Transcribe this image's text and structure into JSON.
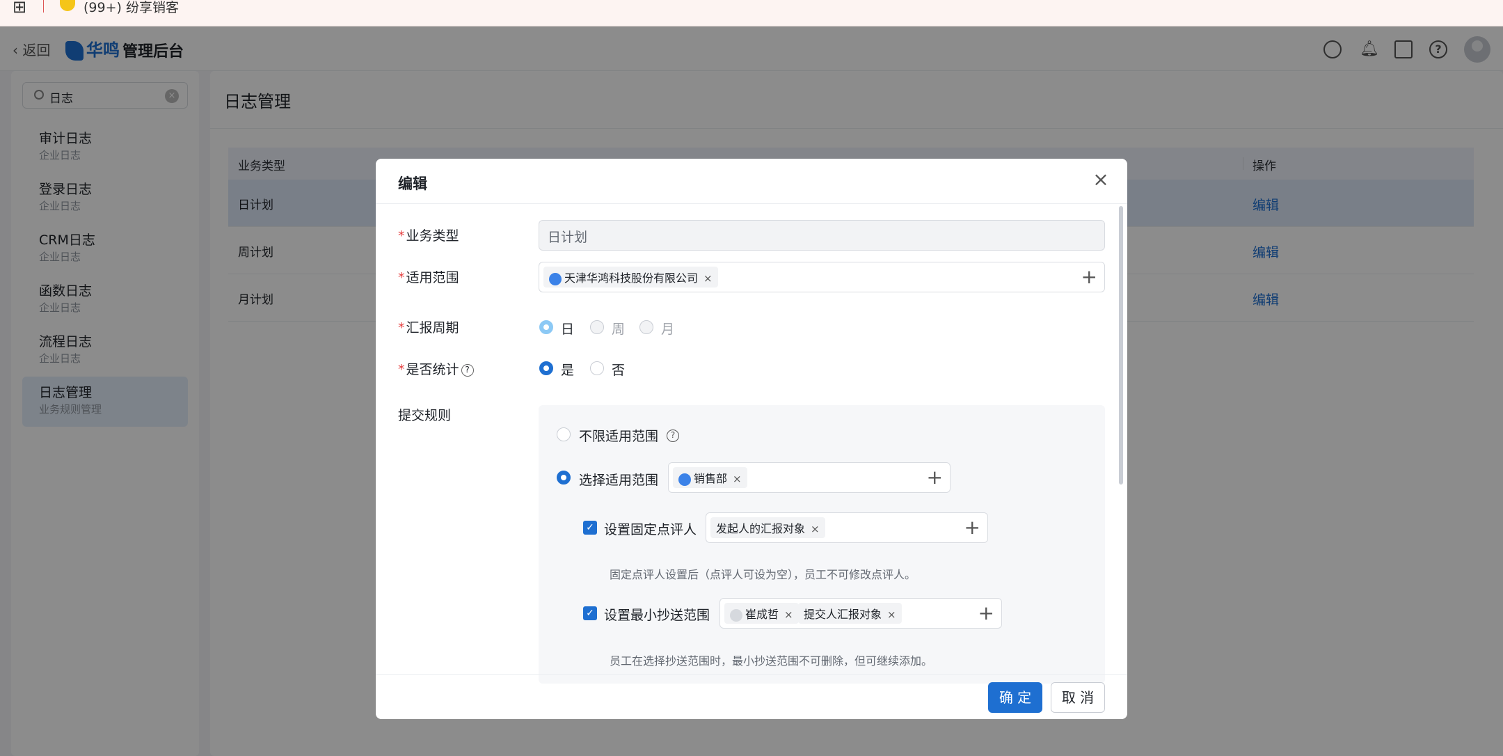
{
  "browser": {
    "tab_title": "(99+) 纷享销客"
  },
  "header": {
    "back_label": "返回",
    "logo_text": "华鸣",
    "app_title": "管理后台"
  },
  "sidebar": {
    "search_value": "日志",
    "items": [
      {
        "title": "审计日志",
        "sub": "企业日志"
      },
      {
        "title": "登录日志",
        "sub": "企业日志"
      },
      {
        "title": "CRM日志",
        "sub": "企业日志"
      },
      {
        "title": "函数日志",
        "sub": "企业日志"
      },
      {
        "title": "流程日志",
        "sub": "企业日志"
      },
      {
        "title": "日志管理",
        "sub": "业务规则管理"
      }
    ]
  },
  "main": {
    "title": "日志管理",
    "columns": [
      "业务类型",
      "操作"
    ],
    "rows": [
      {
        "type": "日计划",
        "action": "编辑"
      },
      {
        "type": "周计划",
        "action": "编辑"
      },
      {
        "type": "月计划",
        "action": "编辑"
      }
    ]
  },
  "dialog": {
    "title": "编辑",
    "business_type_label": "业务类型",
    "business_type_value": "日计划",
    "scope_label": "适用范围",
    "scope_tag": "天津华鸿科技股份有限公司",
    "period_label": "汇报周期",
    "period_options": [
      "日",
      "周",
      "月"
    ],
    "stat_label": "是否统计",
    "stat_options": [
      "是",
      "否"
    ],
    "rule_label": "提交规则",
    "rule_unlimited": "不限适用范围",
    "rule_select": "选择适用范围",
    "rule_select_tag": "销售部",
    "fixed_reviewer_label": "设置固定点评人",
    "fixed_reviewer_tag": "发起人的汇报对象",
    "fixed_reviewer_hint": "固定点评人设置后（点评人可设为空），员工不可修改点评人。",
    "min_cc_label": "设置最小抄送范围",
    "min_cc_tags": [
      "崔成哲",
      "提交人汇报对象"
    ],
    "min_cc_hint": "员工在选择抄送范围时，最小抄送范围不可删除，但可继续添加。",
    "ok_label": "确 定",
    "cancel_label": "取 消"
  }
}
